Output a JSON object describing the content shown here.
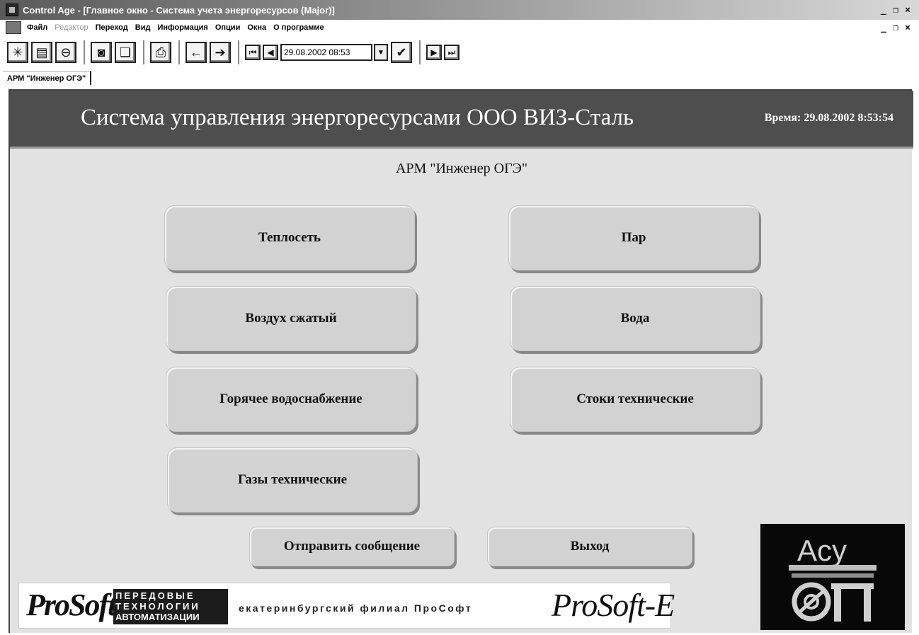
{
  "window": {
    "title": "Control Age - [Главное окно - Система учета энергоресурсов (Major)]"
  },
  "menu": {
    "items": [
      "Файл",
      "Редактор",
      "Переход",
      "Вид",
      "Информация",
      "Опции",
      "Окна",
      "О программе"
    ]
  },
  "toolbar": {
    "datetime": "29.08.2002  08:53"
  },
  "tab": {
    "label": "АРМ \"Инженер ОГЭ\""
  },
  "header": {
    "title": "Система управления энергоресурсами   ООО ВИЗ-Сталь",
    "time": "Время: 29.08.2002 8:53:54"
  },
  "subtitle": "АРМ \"Инженер ОГЭ\"",
  "buttons": {
    "teploset": "Теплосеть",
    "par": "Пар",
    "vozduh": "Воздух сжатый",
    "voda": "Вода",
    "gvs": "Горячее водоснабжение",
    "stoki": "Стоки технические",
    "gazy": "Газы технические",
    "send": "Отправить сообщение",
    "exit": "Выход"
  },
  "footer": {
    "prosoft": "ProSoft",
    "block_line1": "ПЕРЕДОВЫЕ",
    "block_line2": "ТЕХНОЛОГИИ",
    "block_line3": "АВТОМАТИЗАЦИИ",
    "branch": "екатеринбургский филиал ПроСофт",
    "prosoft_e": "ProSoft-E",
    "asu_top": "Асу",
    "asu_bottom": "ТП"
  }
}
